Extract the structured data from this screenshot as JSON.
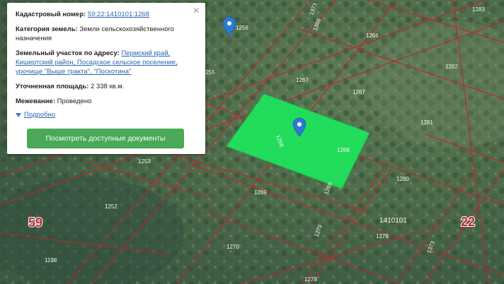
{
  "popup": {
    "close_symbol": "×",
    "cadastral_label": "Кадастровый номер:",
    "cadastral_value": "59:22:1410101:1268",
    "category_label": "Категория земель:",
    "category_value": "Земли сельскохозяйственного назначения",
    "address_label": "Земельный участок по адресу:",
    "address_value": "Пермский край, Кишертский район, Посадское сельское поселение, урочище \"Выше тракта\", \"Поскотина\"",
    "area_label": "Уточненная площадь:",
    "area_value": "2 338 кв.м.",
    "boundary_label": "Межевание:",
    "boundary_value": "Проведено",
    "more_label": "Подробно",
    "docs_button": "Посмотреть доступные документы"
  },
  "map": {
    "parcel_numbers": [
      "1283",
      "1256",
      "1266",
      "1373",
      "1366",
      "1255",
      "1267",
      "1267",
      "1282",
      "1281",
      "1268",
      "1268",
      "1253",
      "1280",
      "1269",
      "1269",
      "1252",
      "1410101",
      "1279",
      "1279",
      "1373",
      "1270",
      "1198",
      "1278"
    ],
    "district_labels": [
      "59",
      "22"
    ],
    "colors": {
      "selected_parcel": "#1ee65d",
      "boundary": "#c0242d",
      "marker": "#2a7ad0"
    },
    "icons": [
      "map-marker-icon",
      "close-icon",
      "caret-down-icon"
    ]
  }
}
